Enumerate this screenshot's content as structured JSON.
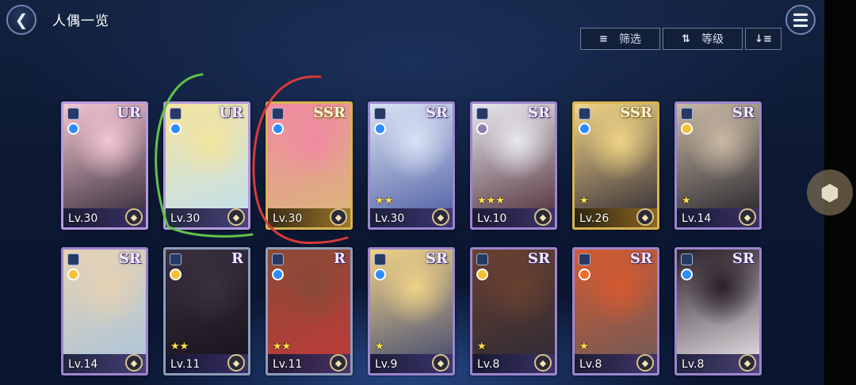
{
  "header": {
    "title": "人偶一览",
    "back_icon": "chevron-left-icon",
    "menu_icon": "hamburger-menu-icon"
  },
  "toolbar": {
    "filter_label": "筛选",
    "filter_icon": "filter-icon",
    "sort_label": "等级",
    "sort_icon": "sort-arrows-icon",
    "order_icon": "sort-descending-icon"
  },
  "side": {
    "cube_icon": "cube-icon"
  },
  "colors": {
    "background": "#0c1833",
    "ur_frame": "#b49ae0",
    "ssr_frame": "#d8b451",
    "sr_frame": "#9b86cf",
    "r_frame": "#8d9cbb",
    "green_mark": "#5fc24a",
    "red_mark": "#d63a3a"
  },
  "cards": [
    {
      "rarity": "UR",
      "level": "Lv.30",
      "stars": 0,
      "role": "water",
      "colors": [
        "#f3c6d2",
        "#2a2230"
      ]
    },
    {
      "rarity": "UR",
      "level": "Lv.30",
      "stars": 0,
      "role": "water",
      "colors": [
        "#f3e4a0",
        "#bfe0f4"
      ]
    },
    {
      "rarity": "SSR",
      "level": "Lv.30",
      "stars": 0,
      "role": "water",
      "colors": [
        "#f08aa2",
        "#d9b878"
      ]
    },
    {
      "rarity": "SR",
      "level": "Lv.30",
      "stars": 2,
      "role": "water",
      "colors": [
        "#d9e2f4",
        "#4a5aa0"
      ]
    },
    {
      "rarity": "SR",
      "level": "Lv.10",
      "stars": 3,
      "role": "dark",
      "colors": [
        "#e8e8ee",
        "#4a2632"
      ]
    },
    {
      "rarity": "SSR",
      "level": "Lv.26",
      "stars": 1,
      "role": "water",
      "colors": [
        "#f0d486",
        "#2a2432"
      ]
    },
    {
      "rarity": "SR",
      "level": "Lv.14",
      "stars": 1,
      "role": "light",
      "colors": [
        "#c9b8a4",
        "#1e1e26"
      ]
    },
    {
      "rarity": "SR",
      "level": "Lv.14",
      "stars": 0,
      "role": "light",
      "colors": [
        "#e6d2b4",
        "#a9c4dc"
      ]
    },
    {
      "rarity": "R",
      "level": "Lv.11",
      "stars": 2,
      "role": "light",
      "colors": [
        "#3a3040",
        "#15121a"
      ]
    },
    {
      "rarity": "R",
      "level": "Lv.11",
      "stars": 2,
      "role": "water",
      "colors": [
        "#8a4a36",
        "#c23a3a"
      ]
    },
    {
      "rarity": "SR",
      "level": "Lv.9",
      "stars": 1,
      "role": "water",
      "colors": [
        "#f0d288",
        "#3a4470"
      ]
    },
    {
      "rarity": "SR",
      "level": "Lv.8",
      "stars": 1,
      "role": "light",
      "colors": [
        "#6a4030",
        "#2a2a36"
      ]
    },
    {
      "rarity": "SR",
      "level": "Lv.8",
      "stars": 1,
      "role": "fire",
      "colors": [
        "#d45a30",
        "#6a5a5a"
      ]
    },
    {
      "rarity": "SR",
      "level": "Lv.8",
      "stars": 0,
      "role": "water",
      "colors": [
        "#2a2028",
        "#f2eef2"
      ]
    }
  ]
}
